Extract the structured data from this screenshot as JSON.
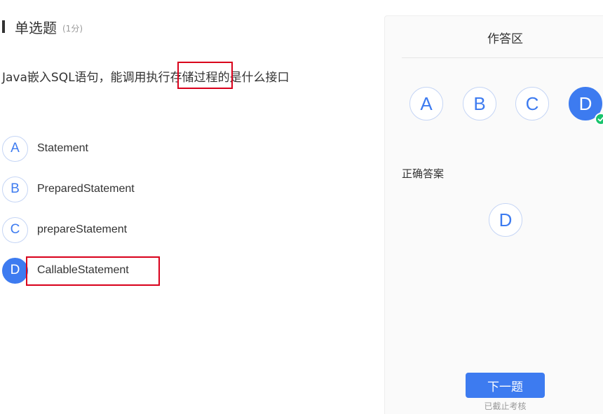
{
  "question": {
    "type_title": "单选题",
    "score": "(1分)",
    "text_before": "Java嵌入SQL语句，能调用执行",
    "text_highlight": "存储过程",
    "text_after": "的是什么接口"
  },
  "options": [
    {
      "letter": "A",
      "label": "Statement",
      "selected": false
    },
    {
      "letter": "B",
      "label": "PreparedStatement",
      "selected": false
    },
    {
      "letter": "C",
      "label": "prepareStatement",
      "selected": false
    },
    {
      "letter": "D",
      "label": "CallableStatement",
      "selected": true
    }
  ],
  "answer_panel": {
    "title": "作答区",
    "choices": [
      "A",
      "B",
      "C",
      "D"
    ],
    "selected": "D",
    "correct_label": "正确答案",
    "correct_answer": "D",
    "next_button": "下一题",
    "deadline_text": "已截止考核"
  },
  "colors": {
    "accent": "#3d7bf0",
    "highlight_box": "#d9001b",
    "check": "#19c46c"
  }
}
